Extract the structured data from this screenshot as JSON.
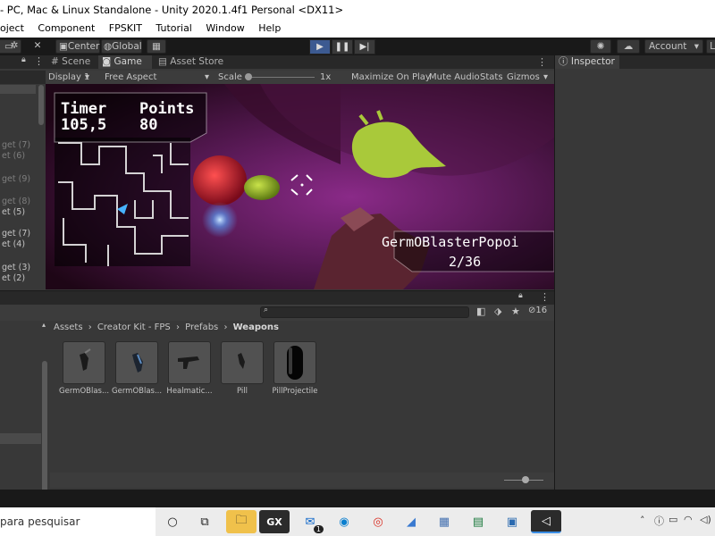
{
  "window": {
    "title": "- PC, Mac & Linux Standalone - Unity 2020.1.4f1 Personal <DX11>"
  },
  "menu": [
    "oject",
    "Component",
    "FPSKIT",
    "Tutorial",
    "Window",
    "Help"
  ],
  "toolbar": {
    "center_label": "Center",
    "global_label": "Global",
    "account_label": "Account",
    "layout_label": "L"
  },
  "tabs": {
    "scene": "Scene",
    "game": "Game",
    "asset_store": "Asset Store",
    "inspector": "Inspector"
  },
  "game_toolbar": {
    "display": "Display 1",
    "aspect": "Free Aspect",
    "scale_label": "Scale",
    "scale_value": "1x",
    "maximize": "Maximize On Play",
    "mute": "Mute Audio",
    "stats": "Stats",
    "gizmos": "Gizmos"
  },
  "hud": {
    "timer_label": "Timer",
    "timer_value": "105,5",
    "points_label": "Points",
    "points_value": "80",
    "weapon_name": "GermOBlasterPopoi",
    "ammo": "2/36"
  },
  "hierarchy": {
    "items": [
      "get (7)",
      "et (6)",
      "get (9)",
      "get (8)",
      "et (5)",
      "get (7)",
      "et (4)",
      "get (3)",
      "et (2)"
    ]
  },
  "project": {
    "search_placeholder": "",
    "breadcrumb": [
      "Assets",
      "Creator Kit - FPS",
      "Prefabs",
      "Weapons"
    ],
    "hidden_count": "16",
    "assets": [
      {
        "label": "GermOBlas...",
        "icon": "blaster"
      },
      {
        "label": "GermOBlas...",
        "icon": "blaster-blue"
      },
      {
        "label": "Healmatic...",
        "icon": "healer"
      },
      {
        "label": "Pill",
        "icon": "pill"
      },
      {
        "label": "PillProjectile",
        "icon": "projectile"
      }
    ]
  },
  "taskbar": {
    "search_text": "para pesquisar",
    "mail_badge": "1"
  }
}
